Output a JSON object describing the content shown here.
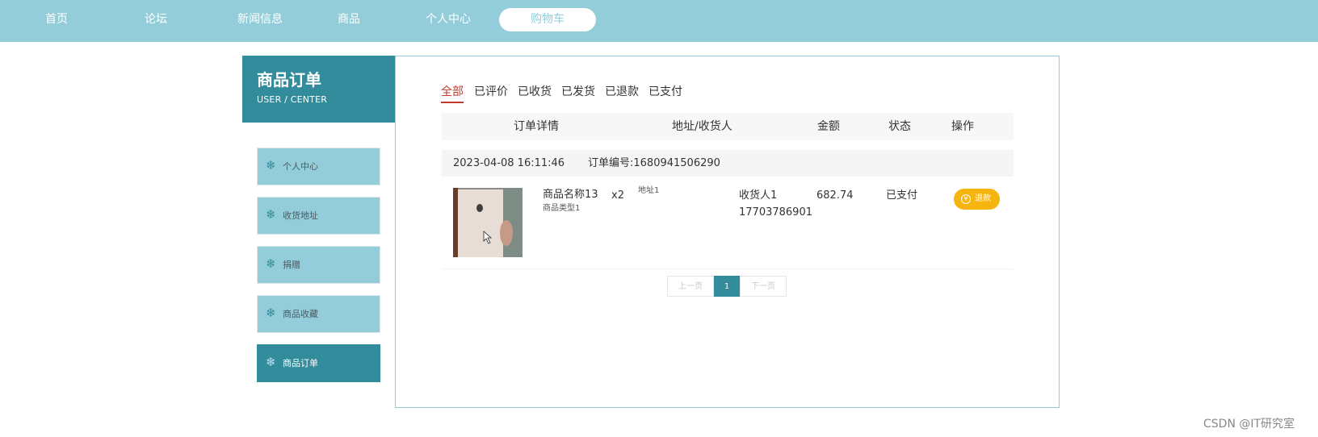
{
  "nav": {
    "items": [
      "首页",
      "论坛",
      "新闻信息",
      "商品",
      "个人中心",
      "购物车"
    ],
    "active_index": 5
  },
  "sidebar": {
    "title": "商品订单",
    "subtitle": "USER / CENTER",
    "icon": "snowflake-icon",
    "items": [
      "个人中心",
      "收货地址",
      "捐赠",
      "商品收藏",
      "商品订单"
    ],
    "active_index": 4
  },
  "tabs": [
    "全部",
    "已评价",
    "已收货",
    "已发货",
    "已退款",
    "已支付"
  ],
  "table": {
    "headers": [
      "订单详情",
      "地址/收货人",
      "金额",
      "状态",
      "操作"
    ]
  },
  "order": {
    "datetime": "2023-04-08 16:11:46",
    "order_no": "订单编号:1680941506290",
    "product_name": "商品名称13",
    "product_type": "商品类型1",
    "quantity": "x2",
    "address": "地址1",
    "receiver": "收货人1",
    "phone": "17703786901",
    "amount": "682.74",
    "status": "已支付",
    "action": "退款"
  },
  "pagination": {
    "prev": "上一页",
    "current": "1",
    "next": "下一页"
  },
  "watermark": "CSDN @IT研究室",
  "colors": {
    "nav_bg": "#93cdd9",
    "primary": "#338c9c",
    "tab_active": "#c0392b",
    "refund_button": "#f6b40f"
  }
}
